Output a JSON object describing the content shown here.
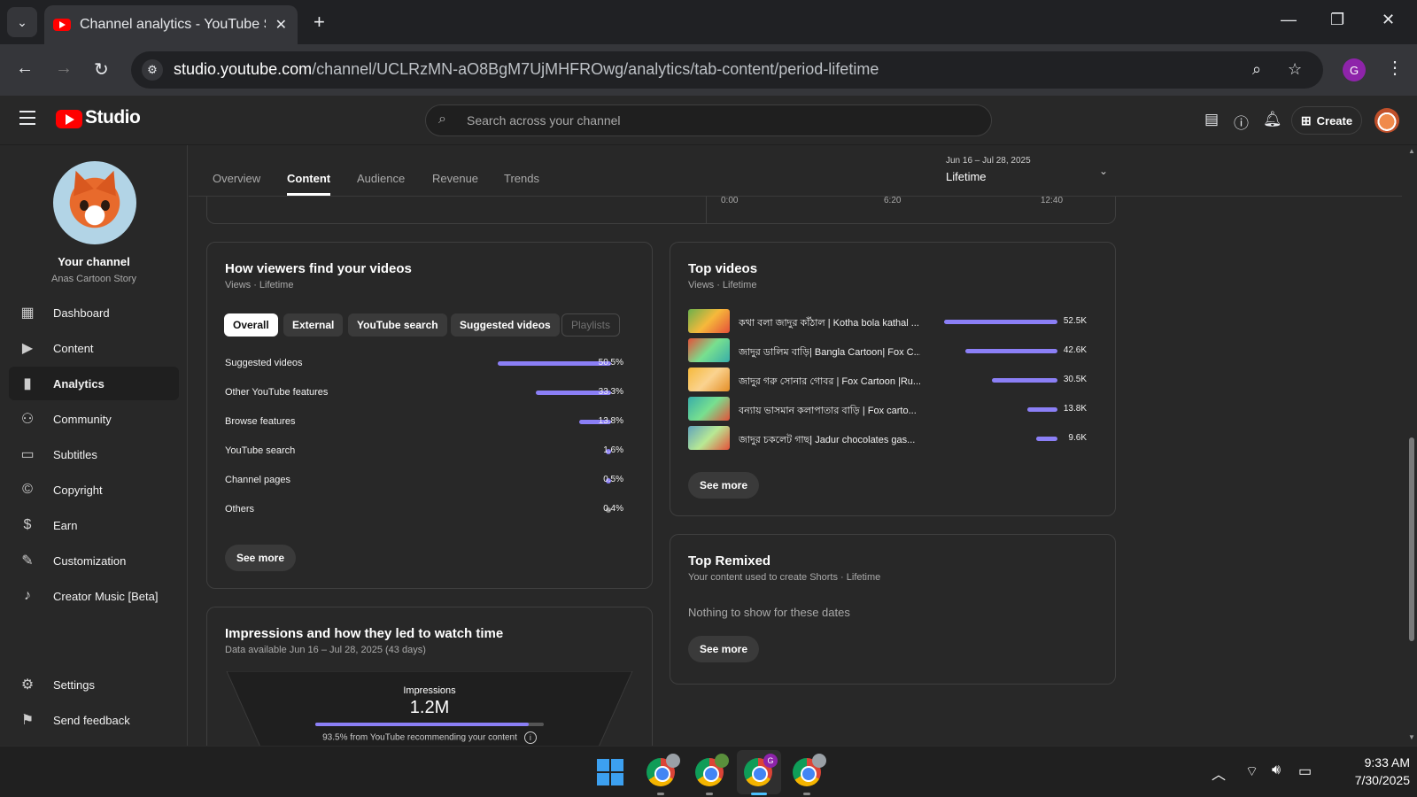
{
  "browser": {
    "tab_title": "Channel analytics - YouTube Studio",
    "url_host": "studio.youtube.com",
    "url_path": "/channel/UCLRzMN-aO8BgM7UjMHFROwg/analytics/tab-content/period-lifetime",
    "profile_initial": "G"
  },
  "header": {
    "logo_text": "Studio",
    "search_placeholder": "Search across your channel",
    "create_label": "Create"
  },
  "sidebar": {
    "your_channel": "Your channel",
    "channel_name": "Anas Cartoon Story",
    "items": [
      {
        "label": "Dashboard",
        "icon": "dashboard-icon"
      },
      {
        "label": "Content",
        "icon": "content-icon"
      },
      {
        "label": "Analytics",
        "icon": "analytics-icon",
        "active": true
      },
      {
        "label": "Community",
        "icon": "community-icon"
      },
      {
        "label": "Subtitles",
        "icon": "subtitles-icon"
      },
      {
        "label": "Copyright",
        "icon": "copyright-icon"
      },
      {
        "label": "Earn",
        "icon": "earn-icon"
      },
      {
        "label": "Customization",
        "icon": "customization-icon"
      },
      {
        "label": "Creator Music [Beta]",
        "icon": "music-icon"
      }
    ],
    "bottom": [
      {
        "label": "Settings",
        "icon": "settings-icon"
      },
      {
        "label": "Send feedback",
        "icon": "feedback-icon"
      }
    ]
  },
  "tabs": [
    "Overview",
    "Content",
    "Audience",
    "Revenue",
    "Trends"
  ],
  "active_tab": "Content",
  "period": {
    "range": "Jun 16 – Jul 28, 2025",
    "label": "Lifetime"
  },
  "chart_ticks": [
    "0:00",
    "6:20",
    "12:40"
  ],
  "how_viewers": {
    "title": "How viewers find your videos",
    "subtitle": "Views · Lifetime",
    "chips": [
      "Overall",
      "External",
      "YouTube search",
      "Suggested videos",
      "Playlists"
    ],
    "rows": [
      {
        "label": "Suggested videos",
        "value": "50.5%",
        "share": 50.5
      },
      {
        "label": "Other YouTube features",
        "value": "33.3%",
        "share": 33.3
      },
      {
        "label": "Browse features",
        "value": "13.8%",
        "share": 13.8
      },
      {
        "label": "YouTube search",
        "value": "1.6%",
        "share": 1.6
      },
      {
        "label": "Channel pages",
        "value": "0.5%",
        "share": 0.5
      },
      {
        "label": "Others",
        "value": "0.4%",
        "share": 0.4
      }
    ],
    "see_more": "See more"
  },
  "top_videos": {
    "title": "Top videos",
    "subtitle": "Views · Lifetime",
    "rows": [
      {
        "title": "কথা বলা জাদুর কাঁঠাল | Kotha bola kathal ...",
        "value": "52.5K",
        "views": 52500
      },
      {
        "title": "জাদুর ডালিম বাড়ি| Bangla Cartoon| Fox C...",
        "value": "42.6K",
        "views": 42600
      },
      {
        "title": "জাদুর গরু সোনার গোবর | Fox Cartoon |Ru...",
        "value": "30.5K",
        "views": 30500
      },
      {
        "title": "বন্যায় ভাসমান কলাপাতার বাড়ি | Fox carto...",
        "value": "13.8K",
        "views": 13800
      },
      {
        "title": "জাদুর চকলেট গাছ| Jadur chocolates gas...",
        "value": "9.6K",
        "views": 9600
      }
    ],
    "see_more": "See more"
  },
  "top_remixed": {
    "title": "Top Remixed",
    "subtitle": "Your content used to create Shorts · Lifetime",
    "empty": "Nothing to show for these dates",
    "see_more": "See more"
  },
  "impressions": {
    "title": "Impressions and how they led to watch time",
    "subtitle": "Data available Jun 16 – Jul 28, 2025 (43 days)",
    "label": "Impressions",
    "value": "1.2M",
    "note": "93.5% from YouTube recommending your content",
    "recommended_share": 93.5
  },
  "taskbar": {
    "time": "9:33 AM",
    "date": "7/30/2025"
  },
  "colors": {
    "accent": "#8b7ff6",
    "brand": "#ff0000"
  }
}
